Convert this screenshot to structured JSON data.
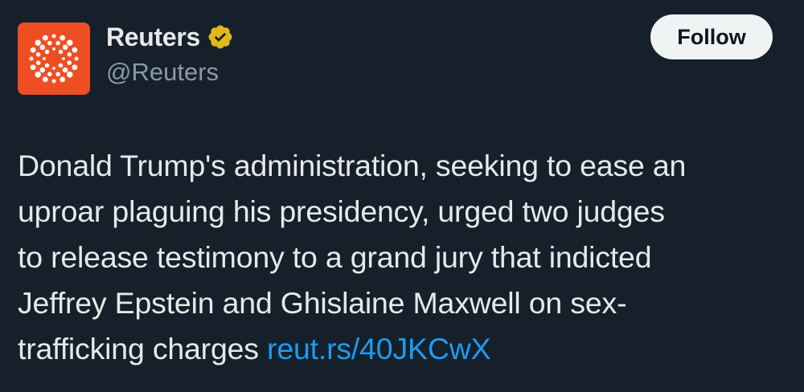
{
  "account": {
    "name": "Reuters",
    "handle": "@Reuters",
    "verified_icon": "gold-verified-badge-icon",
    "avatar_icon": "reuters-dot-ring-logo-icon",
    "avatar_color": "#ef4e23",
    "badge_color": "#e2b719"
  },
  "follow_label": "Follow",
  "tweet": {
    "lines": [
      "Donald Trump's administration, seeking to ease an",
      "uproar plaguing his presidency, urged two judges",
      "to release testimony to a grand jury that indicted",
      "Jeffrey Epstein and Ghislaine Maxwell on sex-",
      "trafficking charges"
    ],
    "link_text": "reut.rs/40JKCwX"
  },
  "colors": {
    "background": "#15202b",
    "text": "#e7e9ea",
    "secondary_text": "#8b98a5",
    "link": "#1d9bf0"
  }
}
